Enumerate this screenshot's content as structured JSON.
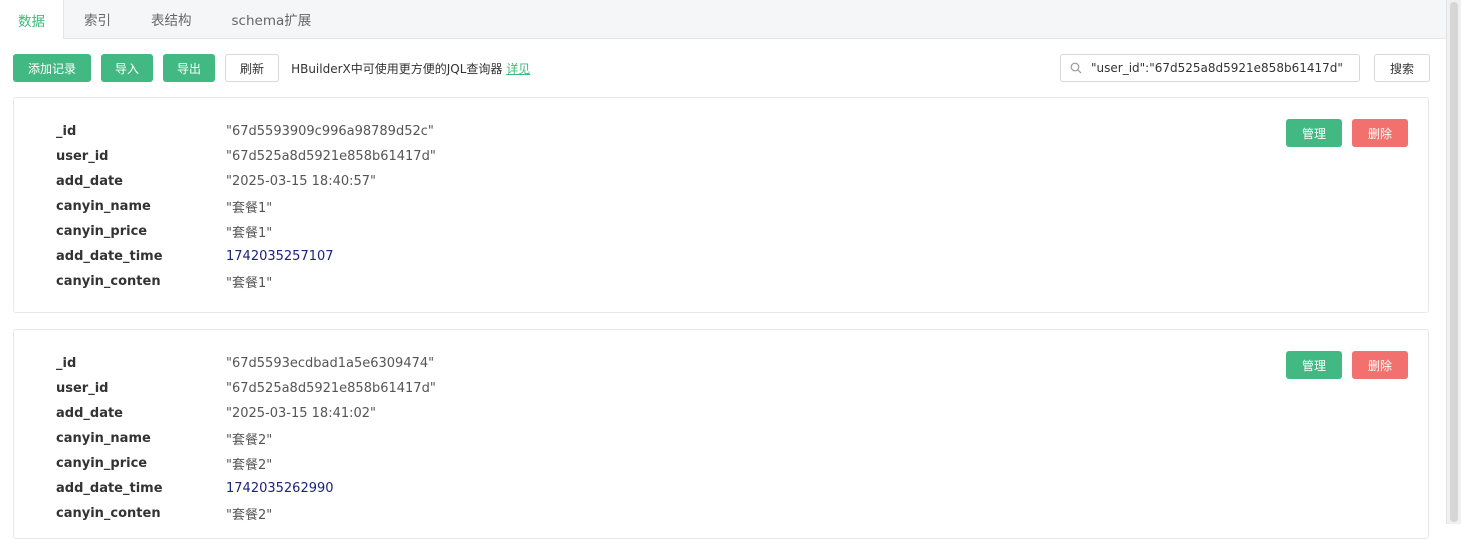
{
  "tabs": [
    {
      "label": "数据",
      "active": true
    },
    {
      "label": "索引",
      "active": false
    },
    {
      "label": "表结构",
      "active": false
    },
    {
      "label": "schema扩展",
      "active": false
    }
  ],
  "toolbar": {
    "add_label": "添加记录",
    "import_label": "导入",
    "export_label": "导出",
    "refresh_label": "刷新",
    "hint_text": "HBuilderX中可使用更方便的JQL查询器",
    "hint_link": "详见"
  },
  "search": {
    "value": "\"user_id\":\"67d525a8d5921e858b61417d\"",
    "button_label": "搜索"
  },
  "record_actions": {
    "manage_label": "管理",
    "delete_label": "删除"
  },
  "records": [
    {
      "fields": [
        {
          "key": "_id",
          "value": "\"67d5593909c996a98789d52c\""
        },
        {
          "key": "user_id",
          "value": "\"67d525a8d5921e858b61417d\""
        },
        {
          "key": "add_date",
          "value": "\"2025-03-15 18:40:57\""
        },
        {
          "key": "canyin_name",
          "value": "\"套餐1\""
        },
        {
          "key": "canyin_price",
          "value": "\"套餐1\""
        },
        {
          "key": "add_date_time",
          "value": "1742035257107"
        },
        {
          "key": "canyin_conten",
          "value": "\"套餐1\""
        }
      ]
    },
    {
      "fields": [
        {
          "key": "_id",
          "value": "\"67d5593ecdbad1a5e6309474\""
        },
        {
          "key": "user_id",
          "value": "\"67d525a8d5921e858b61417d\""
        },
        {
          "key": "add_date",
          "value": "\"2025-03-15 18:41:02\""
        },
        {
          "key": "canyin_name",
          "value": "\"套餐2\""
        },
        {
          "key": "canyin_price",
          "value": "\"套餐2\""
        },
        {
          "key": "add_date_time",
          "value": "1742035262990"
        },
        {
          "key": "canyin_conten",
          "value": "\"套餐2\""
        }
      ]
    }
  ],
  "colors": {
    "accent": "#42b983",
    "danger": "#f2706d",
    "number": "#1a237e"
  },
  "icons": {
    "search": "search-icon"
  }
}
